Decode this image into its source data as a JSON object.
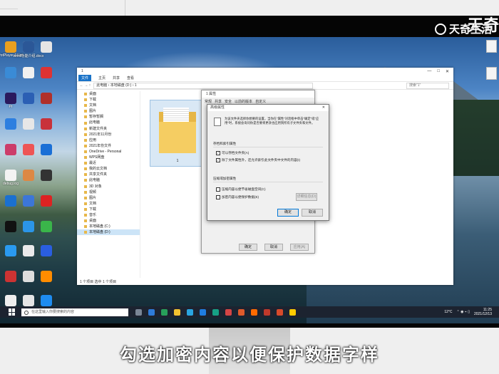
{
  "watermark": {
    "brand": "天奇生活",
    "brand_big": "天奇"
  },
  "caption": "勾选加密内容以便保护数据字样",
  "desktop_icons_left": [
    {
      "label": "",
      "color": "#c44"
    },
    {
      "label": "",
      "color": "#ddd"
    },
    {
      "label": "",
      "color": "#e5e5e5"
    },
    {
      "label": "",
      "color": "#3a8bd6"
    },
    {
      "label": "",
      "color": "#f0f0f0"
    },
    {
      "label": "",
      "color": "#d33"
    },
    {
      "label": "Pr",
      "color": "#2a1a5e"
    },
    {
      "label": "",
      "color": "#2b5fb4"
    },
    {
      "label": "",
      "color": "#b0302a"
    },
    {
      "label": "",
      "color": "#2d7fe0"
    },
    {
      "label": "",
      "color": "#e7e7e7"
    },
    {
      "label": "",
      "color": "#c8323a"
    },
    {
      "label": "",
      "color": "#cc3d6a"
    },
    {
      "label": "",
      "color": "#e55"
    },
    {
      "label": "",
      "color": "#1a6fd6"
    },
    {
      "label": "debug.log",
      "color": "#f3f3f3"
    },
    {
      "label": "",
      "color": "#d84"
    },
    {
      "label": "",
      "color": "#333"
    },
    {
      "label": "",
      "color": "#1a70d0"
    },
    {
      "label": "",
      "color": "#3c76d8"
    },
    {
      "label": "",
      "color": "#d22"
    },
    {
      "label": "",
      "color": "#111"
    },
    {
      "label": "",
      "color": "#2b95e8"
    },
    {
      "label": "",
      "color": "#3ab54a"
    },
    {
      "label": "",
      "color": "#2a9af0"
    },
    {
      "label": "",
      "color": "#eaeaea"
    },
    {
      "label": "",
      "color": "#2a5ee0"
    },
    {
      "label": "",
      "color": "#c33"
    },
    {
      "label": "",
      "color": "#ddd"
    },
    {
      "label": "",
      "color": "#ff8c00"
    },
    {
      "label": "",
      "color": "#eee"
    },
    {
      "label": "",
      "color": "#e5e5e5"
    },
    {
      "label": "",
      "color": "#1e8cf0"
    },
    {
      "label": "PotPlayer 64 bit",
      "color": "#e8a020"
    },
    {
      "label": "word功能介绍.docx",
      "color": "#2b5797"
    }
  ],
  "desktop_icons_right": [
    {
      "label": ""
    },
    {
      "label": ""
    }
  ],
  "explorer": {
    "title": "1",
    "window_controls": [
      "—",
      "□",
      "✕"
    ],
    "ribbon_tabs": [
      "文件",
      "主页",
      "共享",
      "查看"
    ],
    "path": "此电脑 › 本地磁盘 (D:) › 1",
    "search_placeholder": "搜索\"1\"",
    "nav_items": [
      "桌面",
      "下载",
      "文档",
      "图片",
      "暂存暂搁",
      "此电脑",
      "新建文件夹",
      "2021年11月份",
      "应用",
      "2021年份文件",
      "OneDrive - Personal",
      "WPS网盘",
      "最近",
      "我的云文档",
      "共享文件夹",
      "此电脑",
      "3D 对象",
      "视频",
      "图片",
      "文档",
      "下载",
      "音乐",
      "桌面",
      "本地磁盘 (C:)",
      "本地磁盘 (D:)"
    ],
    "selected_nav": 24,
    "folder_name": "1",
    "status": "1 个项目    选中 1 个项目"
  },
  "properties": {
    "title": "1 属性",
    "tabs": [
      "常规",
      "共享",
      "安全",
      "以前的版本",
      "自定义"
    ],
    "ok": "确定",
    "cancel": "取消",
    "apply": "应用(A)"
  },
  "advanced": {
    "title": "高级属性",
    "close": "✕",
    "description": "为该文件夹选择你想要的设置。当你在\"属性\"对话框中单击\"确定\"或\"应用\"时，系统会询问你是否要将更改也应用到所有子文件夹和文件。",
    "group1_title": "存档和索引属性",
    "cb_archive": "可以存档文件夹(A)",
    "cb_index": "除了文件属性外，还允许索引此文件夹中文件的内容(I)",
    "group2_title": "压缩或加密属性",
    "cb_compress": "压缩内容以便节省磁盘空间(C)",
    "cb_encrypt": "加密内容以便保护数据(E)",
    "details_btn": "详细信息(D)",
    "ok": "确定",
    "cancel": "取消"
  },
  "taskbar": {
    "search_placeholder": "在这里输入你要搜索的内容",
    "weather": "12°C",
    "time": "11:25",
    "date": "2021/12/13",
    "app_colors": [
      "#7a8696",
      "#2e7bd8",
      "#27a05a",
      "#f2c230",
      "#2aa5e0",
      "#1f7de0",
      "#16a085",
      "#d64545",
      "#e05a2b",
      "#ff6b00",
      "#c0392b",
      "#d84a2b",
      "#ffcc00"
    ]
  }
}
